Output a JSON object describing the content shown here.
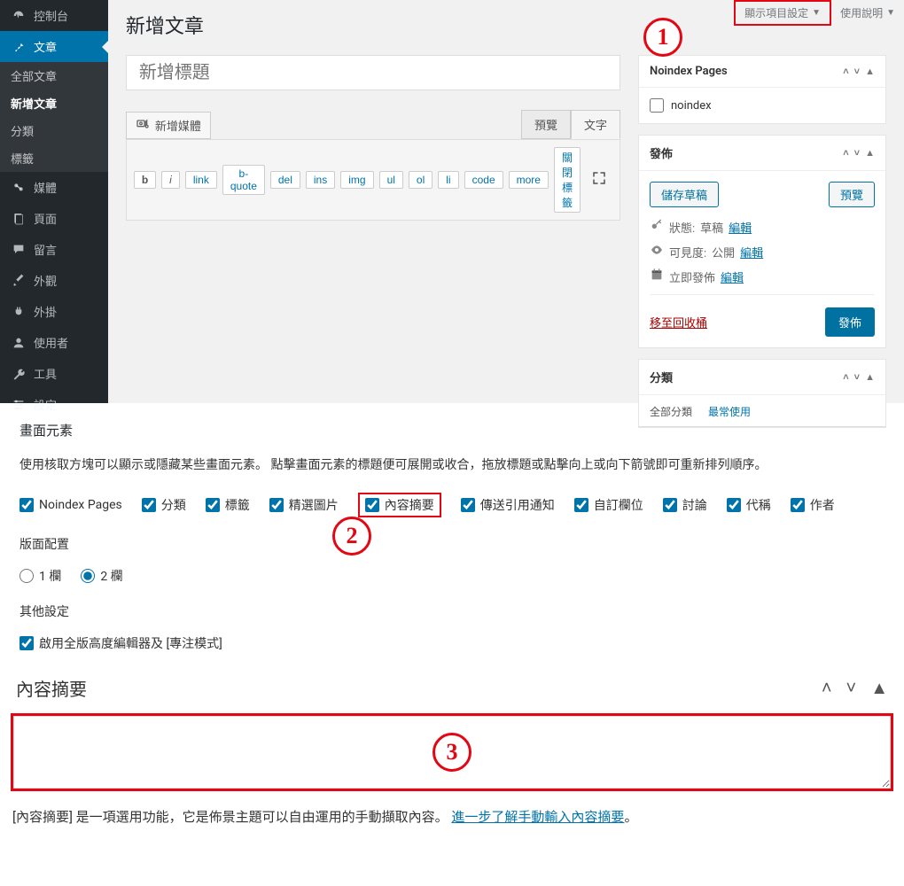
{
  "top_tabs": {
    "screen_options": "顯示項目設定",
    "help": "使用說明"
  },
  "sidebar": {
    "dashboard": "控制台",
    "posts": "文章",
    "posts_sub": {
      "all": "全部文章",
      "new": "新增文章",
      "cat": "分類",
      "tag": "標籤"
    },
    "media": "媒體",
    "pages": "頁面",
    "comments": "留言",
    "appearance": "外觀",
    "plugins": "外掛",
    "users": "使用者",
    "tools": "工具",
    "settings": "設定"
  },
  "page_title": "新增文章",
  "title_placeholder": "新增標題",
  "media_button": "新增媒體",
  "editor_tabs": {
    "visual": "預覽",
    "text": "文字"
  },
  "ed_buttons": [
    "b",
    "i",
    "link",
    "b-quote",
    "del",
    "ins",
    "img",
    "ul",
    "ol",
    "li",
    "code",
    "more",
    "關閉標籤"
  ],
  "noindex_box": {
    "title": "Noindex Pages",
    "label": "noindex"
  },
  "publish_box": {
    "title": "發佈",
    "save_draft": "儲存草稿",
    "preview": "預覽",
    "status_label": "狀態:",
    "status_value": "草稿",
    "edit": "編輯",
    "visibility_label": "可見度:",
    "visibility_value": "公開",
    "schedule": "立即發佈",
    "trash": "移至回收桶",
    "publish": "發佈"
  },
  "category_box": {
    "title": "分類",
    "tab_all": "全部分類",
    "tab_freq": "最常使用"
  },
  "screen_options_panel": {
    "h1": "畫面元素",
    "desc": "使用核取方塊可以顯示或隱藏某些畫面元素。 點擊畫面元素的標題便可展開或收合，拖放標題或點擊向上或向下箭號即可重新排列順序。",
    "boxes": [
      "Noindex Pages",
      "分類",
      "標籤",
      "精選圖片",
      "內容摘要",
      "傳送引用通知",
      "自訂欄位",
      "討論",
      "代稱",
      "作者"
    ],
    "layout_h": "版面配置",
    "layout_opts": [
      "1 欄",
      "2 欄"
    ],
    "layout_sel": 1,
    "other_h": "其他設定",
    "fullheight": "啟用全版高度編輯器及 [專注模式]"
  },
  "excerpt_box": {
    "title": "內容摘要",
    "desc_prefix": "[內容摘要] 是一項選用功能，它是佈景主題可以自由運用的手動擷取內容。",
    "desc_link": "進一步了解手動輸入內容摘要",
    "desc_suffix": "。"
  },
  "annotations": {
    "a1": "1",
    "a2": "2",
    "a3": "3"
  }
}
